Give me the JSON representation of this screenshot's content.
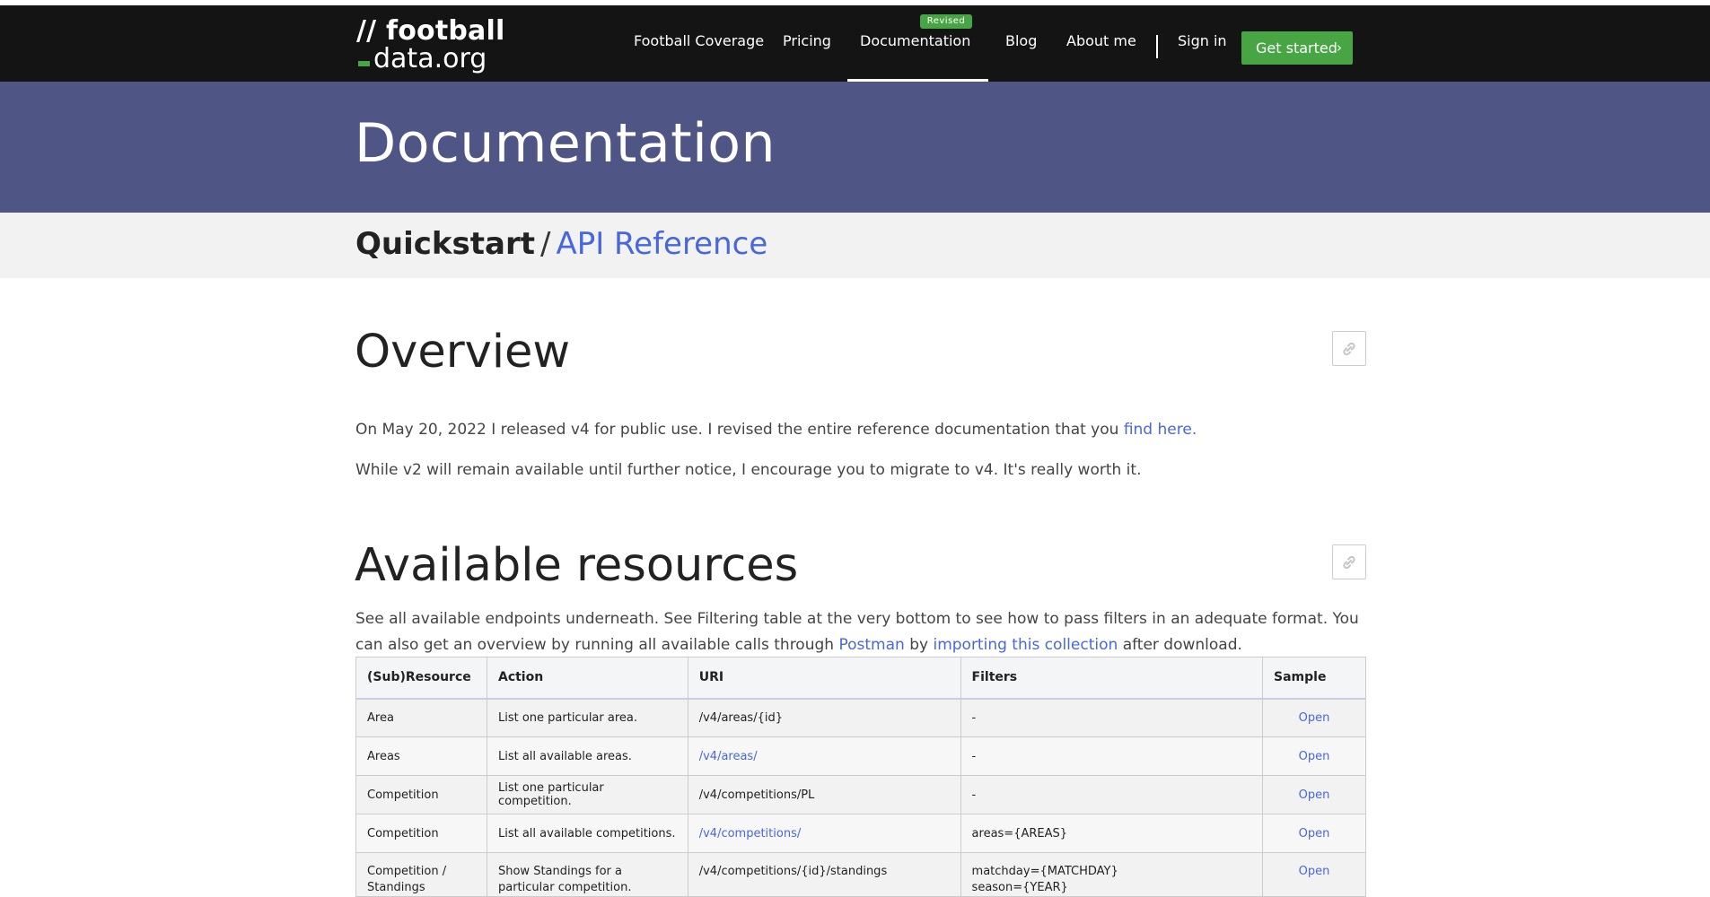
{
  "logo": {
    "line1": "// football",
    "line2": "data.org"
  },
  "nav": {
    "items": [
      {
        "label": "Football Coverage"
      },
      {
        "label": "Pricing"
      },
      {
        "label": "Documentation",
        "badge": "Revised",
        "active": true
      },
      {
        "label": "Blog"
      },
      {
        "label": "About me"
      },
      {
        "label": "Sign in"
      }
    ],
    "cta": "Get started",
    "cta_chevron": "›"
  },
  "hero": {
    "title": "Documentation"
  },
  "breadcrumb": {
    "current": "Quickstart",
    "separator": "/",
    "link": "API Reference"
  },
  "overview": {
    "title": "Overview",
    "p1_text": "On May 20, 2022 I released v4 for public use. I revised the entire reference documentation that you",
    "p1_link": "find here.",
    "p2_text": "While v2 will remain available until further notice, I encourage you to migrate to v4. It's really worth it."
  },
  "resources": {
    "title": "Available resources",
    "intro_a": "See all available endpoints underneath. See Filtering table at the very bottom to see how to pass filters in an adequate format. You can also get an overview by running all available calls through",
    "intro_link1": "Postman",
    "intro_b": "by",
    "intro_link2": "importing this collection",
    "intro_c": "after download.",
    "columns": [
      "(Sub)Resource",
      "Action",
      "URI",
      "Filters",
      "Sample"
    ],
    "rows": [
      {
        "resource": "Area",
        "action": "List one particular area.",
        "uri": "/v4/areas/{id}",
        "uri_link": false,
        "filters": "-",
        "sample": "Open"
      },
      {
        "resource": "Areas",
        "action": "List all available areas.",
        "uri": "/v4/areas/",
        "uri_link": true,
        "filters": "-",
        "sample": "Open"
      },
      {
        "resource": "Competition",
        "action": "List one particular competition.",
        "uri": "/v4/competitions/PL",
        "uri_link": false,
        "filters": "-",
        "sample": "Open"
      },
      {
        "resource": "Competition",
        "action": "List all available competitions.",
        "uri": "/v4/competitions/",
        "uri_link": true,
        "filters": "areas={AREAS}",
        "sample": "Open"
      },
      {
        "resource": "Competition / Standings",
        "action": "Show Standings for a particular competition.",
        "uri": "/v4/competitions/{id}/standings",
        "uri_link": false,
        "filters": "matchday={MATCHDAY}\nseason={YEAR}",
        "sample": "Open"
      }
    ]
  },
  "colors": {
    "navbar": "#141414",
    "hero": "#4f5686",
    "accent_green": "#48a544",
    "link_blue": "#4767dd",
    "crumb_bg": "#f2f2f2"
  },
  "icons": {
    "anchor": "link-icon",
    "cta": "chevron-right-icon"
  }
}
